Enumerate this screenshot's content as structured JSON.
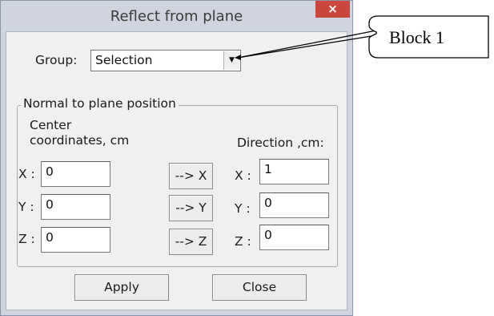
{
  "window": {
    "title": "Reflect from plane",
    "close_glyph": "×"
  },
  "group": {
    "label": "Group:",
    "selected": "Selection",
    "arrow_glyph": "▼"
  },
  "normal_section": {
    "legend": "Normal to plane position",
    "center_heading_line1": "Center",
    "center_heading_line2": "coordinates, cm",
    "direction_heading": "Direction ,cm:",
    "center": {
      "x_label": "X :",
      "x_value": "0",
      "y_label": "Y :",
      "y_value": "0",
      "z_label": "Z :",
      "z_value": "0"
    },
    "direction": {
      "x_label": "X :",
      "x_value": "1",
      "y_label": "Y :",
      "y_value": "0",
      "z_label": "Z :",
      "z_value": "0"
    },
    "copy_buttons": {
      "x": "--> X",
      "y": "--> Y",
      "z": "--> Z"
    }
  },
  "actions": {
    "apply": "Apply",
    "close": "Close"
  },
  "annotation": {
    "callout_text": "Block 1"
  }
}
